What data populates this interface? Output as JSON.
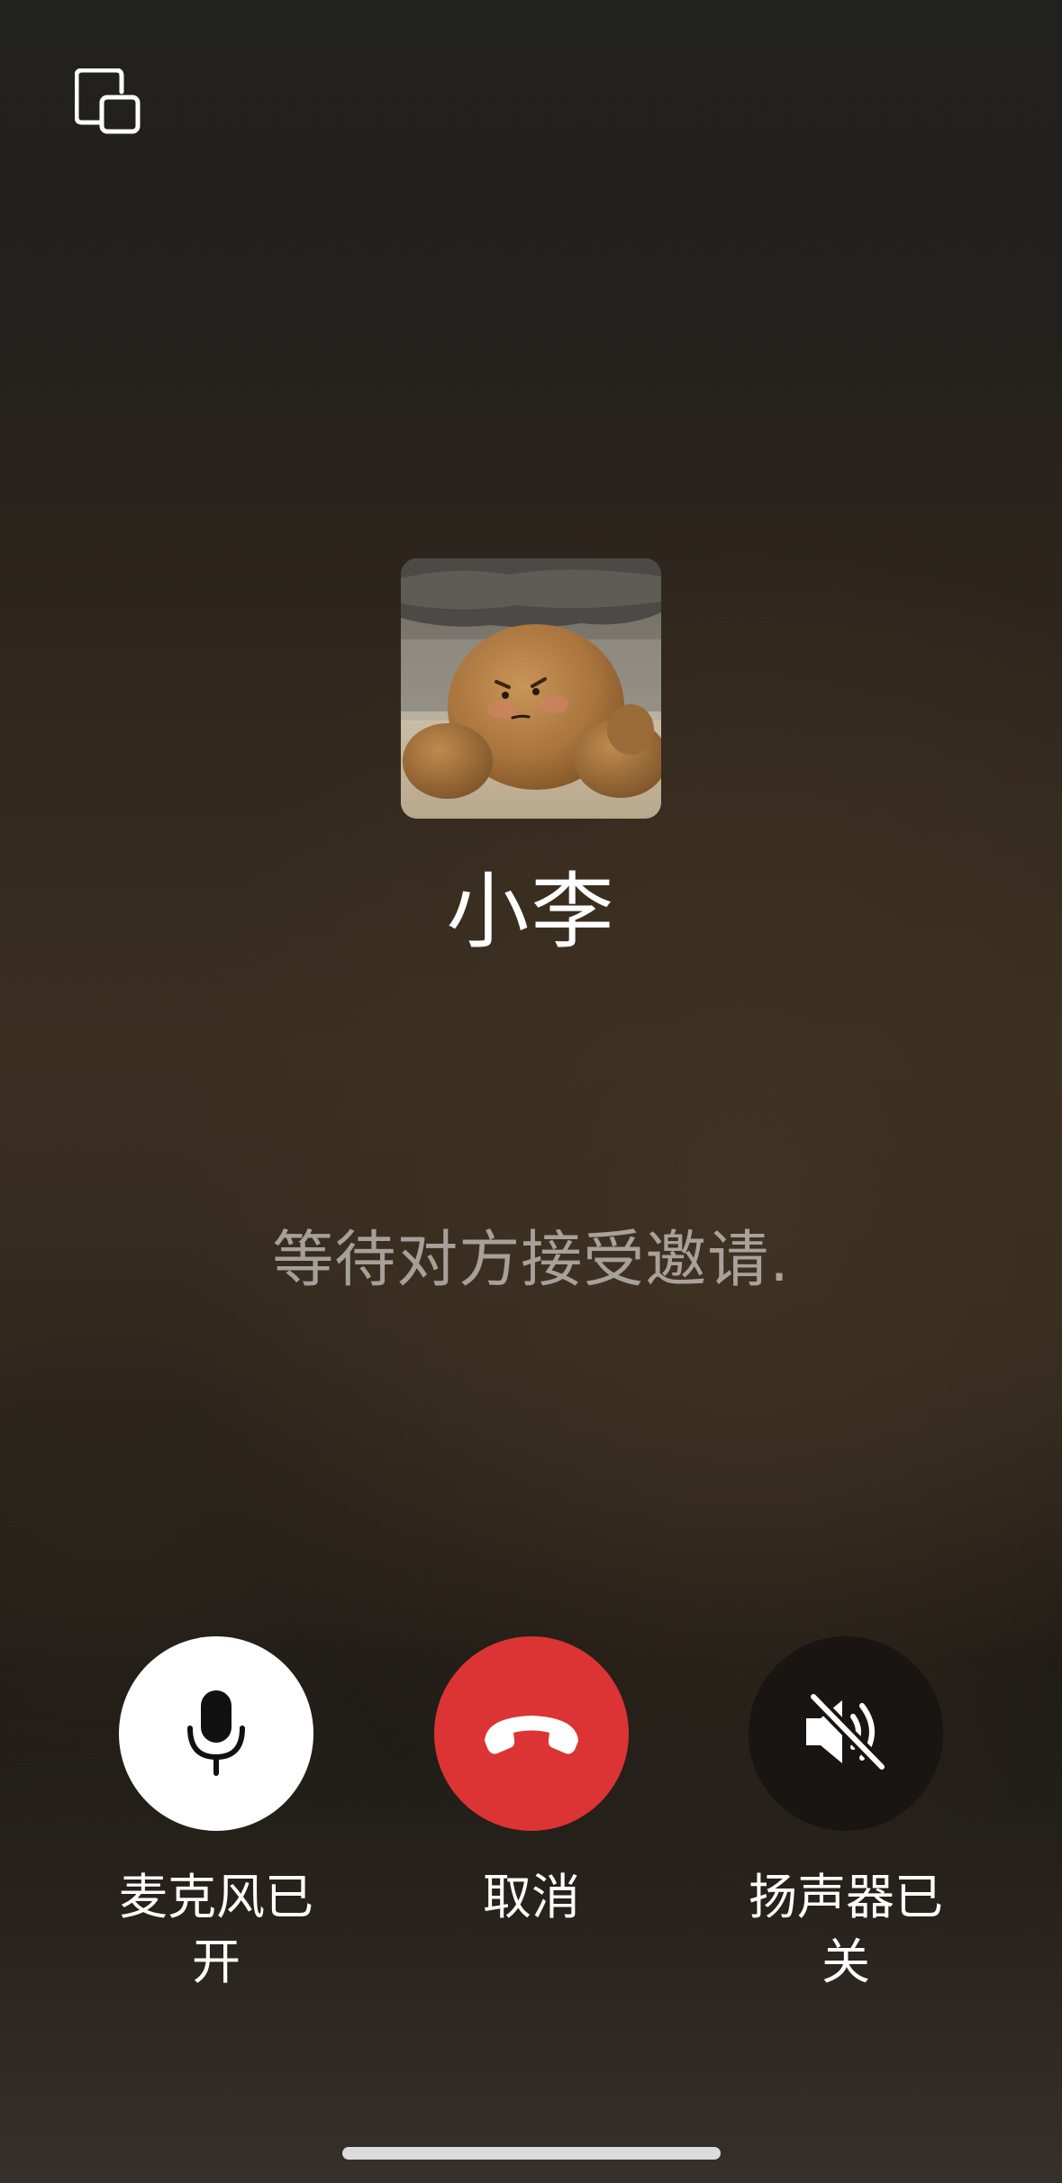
{
  "top_bar": {
    "minimize_icon": "picture-in-picture-icon"
  },
  "contact": {
    "name": "小李",
    "avatar": "potato-character-avatar"
  },
  "call": {
    "status": "等待对方接受邀请."
  },
  "controls": {
    "mic": {
      "label": "麦克风已开",
      "icon": "microphone-icon",
      "state": "on"
    },
    "cancel": {
      "label": "取消",
      "icon": "hang-up-icon"
    },
    "speaker": {
      "label": "扬声器已关",
      "icon": "speaker-muted-icon",
      "state": "off"
    }
  },
  "colors": {
    "cancel_red": "#dc3434",
    "mic_on_bg": "#ffffff",
    "speaker_off_bg": "#181512",
    "status_text": "rgba(255,255,255,0.55)"
  }
}
